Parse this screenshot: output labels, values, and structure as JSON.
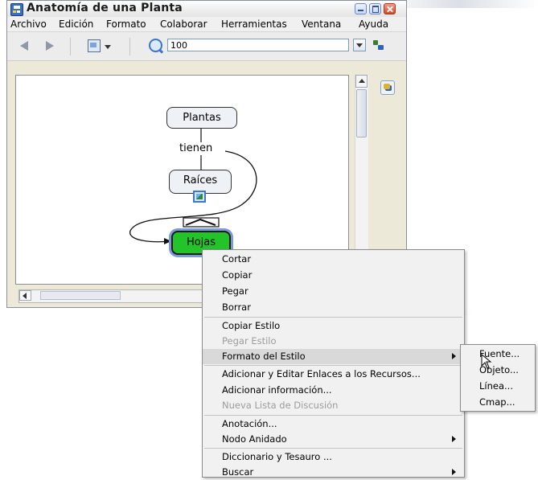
{
  "window": {
    "title": "Anatomía de una Planta"
  },
  "menubar": [
    "Archivo",
    "Edición",
    "Formato",
    "Colaborar",
    "Herramientas",
    "Ventana",
    "Ayuda"
  ],
  "toolbar": {
    "zoom_value": "100"
  },
  "concept_map": {
    "nodes": {
      "plantas": "Plantas",
      "raices": "Raíces",
      "hojas": "Hojas"
    },
    "linking_phrase": "tienen"
  },
  "context_menu": {
    "items": [
      {
        "label": "Cortar",
        "enabled": true
      },
      {
        "label": "Copiar",
        "enabled": true
      },
      {
        "label": "Pegar",
        "enabled": true
      },
      {
        "label": "Borrar",
        "enabled": true
      },
      {
        "label": "Copiar Estilo",
        "enabled": true
      },
      {
        "label": "Pegar Estilo",
        "enabled": false
      },
      {
        "label": "Formato del Estilo",
        "enabled": true,
        "submenu": true,
        "highlighted": true
      },
      {
        "label": "Adicionar y Editar Enlaces a los Recursos...",
        "enabled": true
      },
      {
        "label": "Adicionar información...",
        "enabled": true
      },
      {
        "label": "Nueva Lista de Discusión",
        "enabled": false
      },
      {
        "label": "Anotación...",
        "enabled": true
      },
      {
        "label": "Nodo Anidado",
        "enabled": true,
        "submenu": true
      },
      {
        "label": "Diccionario y Tesauro ...",
        "enabled": true
      },
      {
        "label": "Buscar",
        "enabled": true,
        "submenu": true
      }
    ]
  },
  "submenu": {
    "items": [
      "Fuente...",
      "Objeto...",
      "Línea...",
      "Cmap..."
    ]
  },
  "colors": {
    "selected_node": "#22c42a",
    "selection_outline": "#7a9ad8",
    "menu_background": "#f1f1f1",
    "menu_highlight": "#d9d9d9"
  },
  "icons": [
    "app-icon",
    "back-arrow-icon",
    "forward-arrow-icon",
    "view-mode-icon",
    "zoom-icon",
    "dropdown-icon",
    "tools-icon",
    "collaboration-icon",
    "image-resource-icon",
    "mouse-pointer-icon"
  ]
}
